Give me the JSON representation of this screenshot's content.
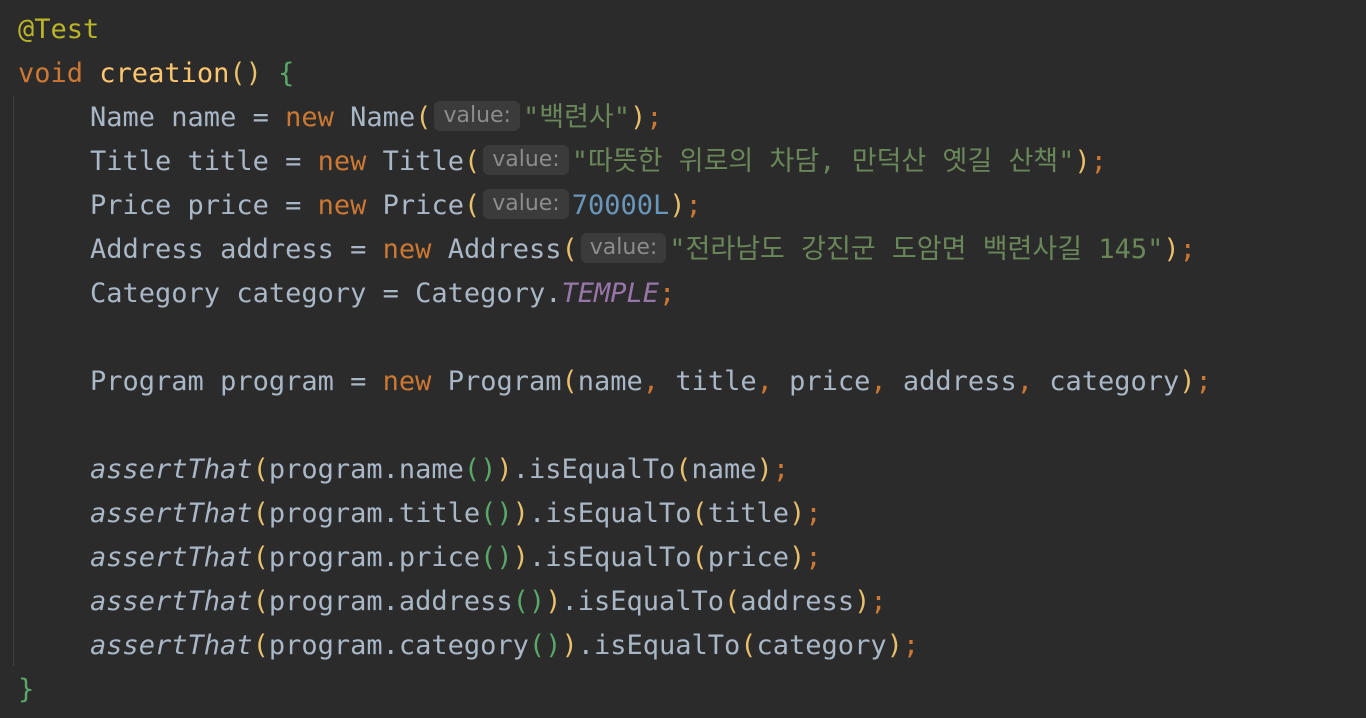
{
  "code": {
    "annotation": "@Test",
    "method": {
      "kw": "void",
      "name": "creation",
      "open": "()",
      "brace": "{"
    },
    "stmts": {
      "name": {
        "type": "Name",
        "var": "name",
        "eq": "=",
        "kw": "new",
        "ctor": "Name",
        "hint": "value:",
        "arg": "\"백련사\""
      },
      "title": {
        "type": "Title",
        "var": "title",
        "eq": "=",
        "kw": "new",
        "ctor": "Title",
        "hint": "value:",
        "arg": "\"따뜻한 위로의 차담, 만덕산 옛길 산책\""
      },
      "price": {
        "type": "Price",
        "var": "price",
        "eq": "=",
        "kw": "new",
        "ctor": "Price",
        "hint": "value:",
        "arg": "70000L"
      },
      "address": {
        "type": "Address",
        "var": "address",
        "eq": "=",
        "kw": "new",
        "ctor": "Address",
        "hint": "value:",
        "arg": "\"전라남도 강진군 도암면 백련사길 145\""
      },
      "category": {
        "type": "Category",
        "var": "category",
        "eq": "=",
        "qual": "Category.",
        "const": "TEMPLE"
      },
      "program": {
        "type": "Program",
        "var": "program",
        "eq": "=",
        "kw": "new",
        "ctor": "Program",
        "args": [
          "name",
          "title",
          "price",
          "address",
          "category"
        ]
      }
    },
    "asserts": [
      {
        "fn": "assertThat",
        "receiver": "program.",
        "getter": "name",
        "check": ".isEqualTo",
        "expected": "name"
      },
      {
        "fn": "assertThat",
        "receiver": "program.",
        "getter": "title",
        "check": ".isEqualTo",
        "expected": "title"
      },
      {
        "fn": "assertThat",
        "receiver": "program.",
        "getter": "price",
        "check": ".isEqualTo",
        "expected": "price"
      },
      {
        "fn": "assertThat",
        "receiver": "program.",
        "getter": "address",
        "check": ".isEqualTo",
        "expected": "address"
      },
      {
        "fn": "assertThat",
        "receiver": "program.",
        "getter": "category",
        "check": ".isEqualTo",
        "expected": "category"
      }
    ],
    "close_brace": "}"
  },
  "colors": {
    "background": "#2b2b2b",
    "text": "#a9b7c6",
    "keyword": "#cc7832",
    "annotation": "#bbb529",
    "function": "#ffc66d",
    "string": "#6a8759",
    "number": "#6897bb",
    "constant": "#9876aa",
    "hint_bg": "#3b3b3b",
    "hint_text": "#8c8c8c"
  }
}
